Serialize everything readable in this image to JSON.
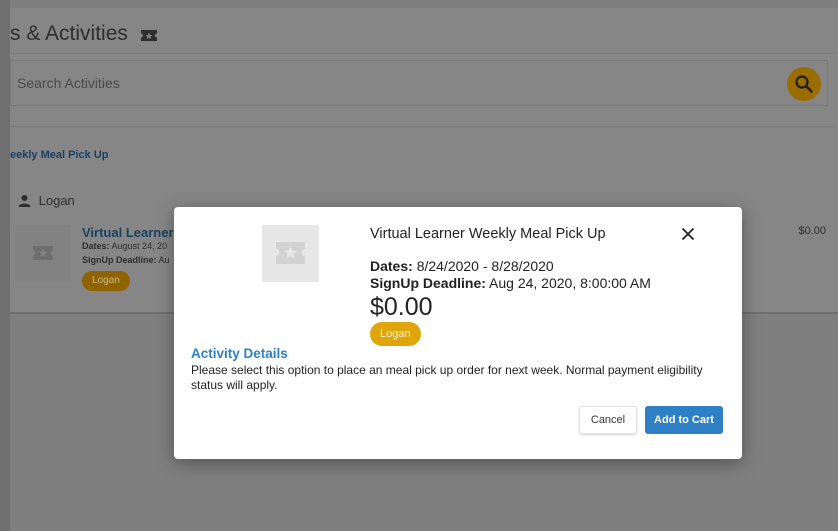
{
  "page": {
    "title": "s & Activities",
    "search_placeholder": "Search Activities",
    "section_link": "eekly Meal Pick Up",
    "person": "Logan",
    "item": {
      "title": "Virtual Learner W",
      "dates_label": "Dates:",
      "dates_value": "August 24, 20",
      "deadline_label": "SignUp Deadline:",
      "deadline_value": "Au",
      "chip": "Logan",
      "price": "$0.00"
    }
  },
  "modal": {
    "title": "Virtual Learner Weekly Meal Pick Up",
    "dates_label": "Dates:",
    "dates_value": "8/24/2020 - 8/28/2020",
    "deadline_label": "SignUp Deadline:",
    "deadline_value": "Aug 24, 2020, 8:00:00 AM",
    "price": "$0.00",
    "participant_chip": "Logan",
    "details_heading": "Activity Details",
    "details_text": "Please select this option to place an meal pick up order for next week. Normal payment eligibility status will apply.",
    "cancel_label": "Cancel",
    "add_label": "Add to Cart"
  },
  "icons": {
    "ticket": "ticket-icon",
    "search": "search-icon",
    "person": "person-icon",
    "star_placeholder": "star-ticket-icon",
    "close": "close-icon"
  },
  "colors": {
    "accent_blue": "#2f7fc4",
    "chip_gold": "#e0a50a",
    "overlay": "#7f7f7f"
  }
}
